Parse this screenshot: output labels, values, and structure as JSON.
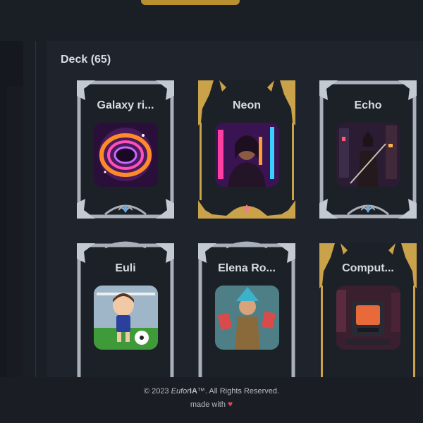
{
  "deck": {
    "title": "Deck (65)",
    "cards": [
      {
        "name": "Galaxy ri...",
        "frame": "silver",
        "art": "galaxy-portal"
      },
      {
        "name": "Neon",
        "frame": "gold",
        "art": "neon-woman"
      },
      {
        "name": "Echo",
        "frame": "silver",
        "art": "cyber-warrior"
      },
      {
        "name": "Euli",
        "frame": "silver",
        "art": "soccer-boy"
      },
      {
        "name": "Elena Ro...",
        "frame": "silver",
        "art": "card-sorceress"
      },
      {
        "name": "Comput...",
        "frame": "gold",
        "art": "retro-computer"
      }
    ]
  },
  "footer": {
    "copyright_prefix": "© 2023 ",
    "brand_first": "Eufor",
    "brand_second": "IA",
    "copyright_suffix": "™. All Rights Reserved.",
    "made_with": "made with",
    "heart_icon": "heart-icon"
  },
  "colors": {
    "background": "#1a1e25",
    "panel": "#1f232b",
    "gold_accent": "#b8902f",
    "silver_frame": "#a9b0ba",
    "gold_frame": "#c9a24a",
    "heart": "#e0455f"
  }
}
